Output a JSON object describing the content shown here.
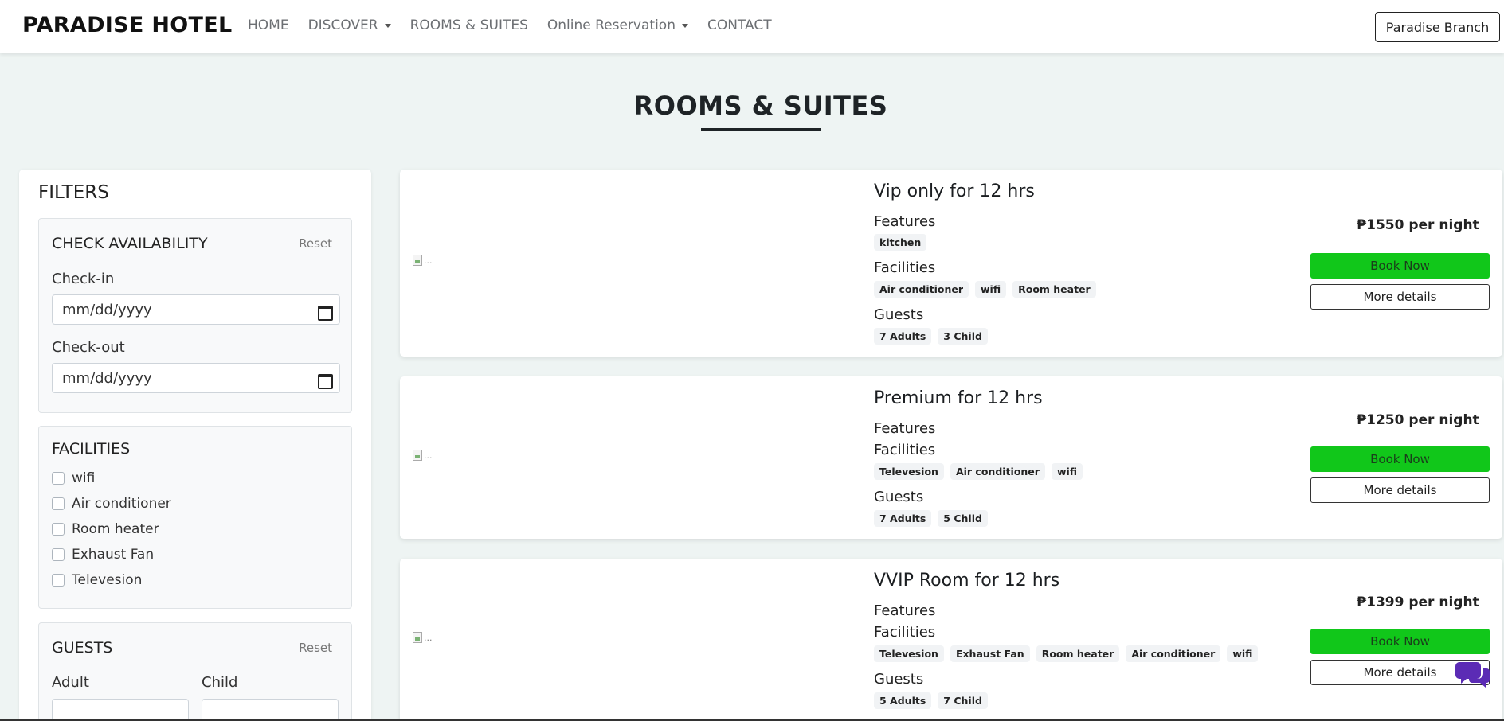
{
  "navbar": {
    "brand": "PARADISE HOTEL",
    "links": [
      {
        "label": "HOME",
        "dropdown": false
      },
      {
        "label": "DISCOVER",
        "dropdown": true
      },
      {
        "label": "ROOMS & SUITES",
        "dropdown": false
      },
      {
        "label": "Online Reservation",
        "dropdown": true
      },
      {
        "label": "CONTACT",
        "dropdown": false
      }
    ],
    "branch_button": "Paradise Branch"
  },
  "page": {
    "title": "ROOMS & SUITES"
  },
  "filters": {
    "title": "FILTERS",
    "availability": {
      "title": "CHECK AVAILABILITY",
      "reset": "Reset",
      "checkin_label": "Check-in",
      "checkin_value": "mm/dd/yyyy",
      "checkout_label": "Check-out",
      "checkout_value": "mm/dd/yyyy"
    },
    "facilities": {
      "title": "FACILITIES",
      "items": [
        "wifi",
        "Air conditioner",
        "Room heater",
        "Exhaust Fan",
        "Televesion"
      ]
    },
    "guests": {
      "title": "GUESTS",
      "reset": "Reset",
      "adult_label": "Adult",
      "child_label": "Child"
    }
  },
  "rooms": [
    {
      "name": "Vip only for 12 hrs",
      "features_label": "Features",
      "features": [
        "kitchen"
      ],
      "facilities_label": "Facilities",
      "facilities": [
        "Air conditioner",
        "wifi",
        "Room heater"
      ],
      "guests_label": "Guests",
      "guests": [
        "7 Adults",
        "3 Child"
      ],
      "price": "₱1550 per night",
      "book_label": "Book Now",
      "details_label": "More details",
      "image_alt": "..."
    },
    {
      "name": "Premium for 12 hrs",
      "features_label": "Features",
      "features": [],
      "facilities_label": "Facilities",
      "facilities": [
        "Televesion",
        "Air conditioner",
        "wifi"
      ],
      "guests_label": "Guests",
      "guests": [
        "7 Adults",
        "5 Child"
      ],
      "price": "₱1250 per night",
      "book_label": "Book Now",
      "details_label": "More details",
      "image_alt": "..."
    },
    {
      "name": "VVIP Room for 12 hrs",
      "features_label": "Features",
      "features": [],
      "facilities_label": "Facilities",
      "facilities": [
        "Televesion",
        "Exhaust Fan",
        "Room heater",
        "Air conditioner",
        "wifi"
      ],
      "guests_label": "Guests",
      "guests": [
        "5 Adults",
        "7 Child"
      ],
      "price": "₱1399 per night",
      "book_label": "Book Now",
      "details_label": "More details",
      "image_alt": "..."
    }
  ],
  "colors": {
    "page_bg": "#eef4f3",
    "book_button": "#11c71a",
    "chat_icon": "#5b2bb5"
  },
  "icons": {
    "chat": "chat-bubbles-icon",
    "calendar": "calendar-icon",
    "caret": "caret-down-icon"
  }
}
